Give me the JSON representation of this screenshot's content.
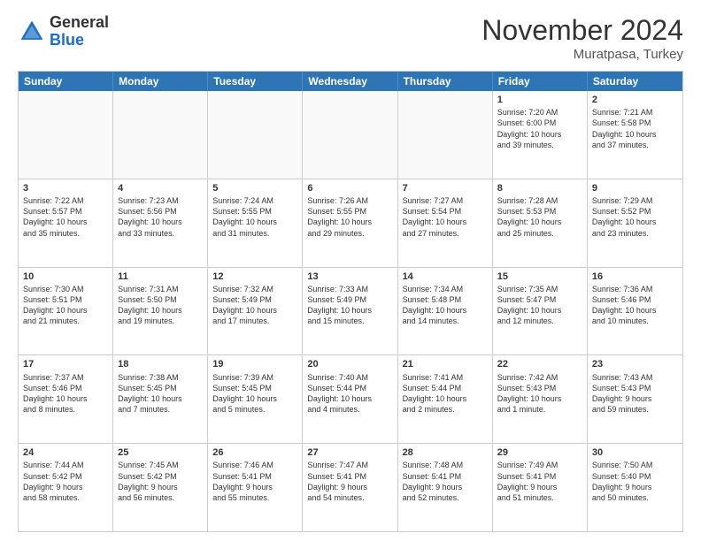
{
  "logo": {
    "general": "General",
    "blue": "Blue"
  },
  "header": {
    "month": "November 2024",
    "location": "Muratpasa, Turkey"
  },
  "weekdays": [
    "Sunday",
    "Monday",
    "Tuesday",
    "Wednesday",
    "Thursday",
    "Friday",
    "Saturday"
  ],
  "rows": [
    [
      {
        "day": "",
        "info": ""
      },
      {
        "day": "",
        "info": ""
      },
      {
        "day": "",
        "info": ""
      },
      {
        "day": "",
        "info": ""
      },
      {
        "day": "",
        "info": ""
      },
      {
        "day": "1",
        "info": "Sunrise: 7:20 AM\nSunset: 6:00 PM\nDaylight: 10 hours\nand 39 minutes."
      },
      {
        "day": "2",
        "info": "Sunrise: 7:21 AM\nSunset: 5:58 PM\nDaylight: 10 hours\nand 37 minutes."
      }
    ],
    [
      {
        "day": "3",
        "info": "Sunrise: 7:22 AM\nSunset: 5:57 PM\nDaylight: 10 hours\nand 35 minutes."
      },
      {
        "day": "4",
        "info": "Sunrise: 7:23 AM\nSunset: 5:56 PM\nDaylight: 10 hours\nand 33 minutes."
      },
      {
        "day": "5",
        "info": "Sunrise: 7:24 AM\nSunset: 5:55 PM\nDaylight: 10 hours\nand 31 minutes."
      },
      {
        "day": "6",
        "info": "Sunrise: 7:26 AM\nSunset: 5:55 PM\nDaylight: 10 hours\nand 29 minutes."
      },
      {
        "day": "7",
        "info": "Sunrise: 7:27 AM\nSunset: 5:54 PM\nDaylight: 10 hours\nand 27 minutes."
      },
      {
        "day": "8",
        "info": "Sunrise: 7:28 AM\nSunset: 5:53 PM\nDaylight: 10 hours\nand 25 minutes."
      },
      {
        "day": "9",
        "info": "Sunrise: 7:29 AM\nSunset: 5:52 PM\nDaylight: 10 hours\nand 23 minutes."
      }
    ],
    [
      {
        "day": "10",
        "info": "Sunrise: 7:30 AM\nSunset: 5:51 PM\nDaylight: 10 hours\nand 21 minutes."
      },
      {
        "day": "11",
        "info": "Sunrise: 7:31 AM\nSunset: 5:50 PM\nDaylight: 10 hours\nand 19 minutes."
      },
      {
        "day": "12",
        "info": "Sunrise: 7:32 AM\nSunset: 5:49 PM\nDaylight: 10 hours\nand 17 minutes."
      },
      {
        "day": "13",
        "info": "Sunrise: 7:33 AM\nSunset: 5:49 PM\nDaylight: 10 hours\nand 15 minutes."
      },
      {
        "day": "14",
        "info": "Sunrise: 7:34 AM\nSunset: 5:48 PM\nDaylight: 10 hours\nand 14 minutes."
      },
      {
        "day": "15",
        "info": "Sunrise: 7:35 AM\nSunset: 5:47 PM\nDaylight: 10 hours\nand 12 minutes."
      },
      {
        "day": "16",
        "info": "Sunrise: 7:36 AM\nSunset: 5:46 PM\nDaylight: 10 hours\nand 10 minutes."
      }
    ],
    [
      {
        "day": "17",
        "info": "Sunrise: 7:37 AM\nSunset: 5:46 PM\nDaylight: 10 hours\nand 8 minutes."
      },
      {
        "day": "18",
        "info": "Sunrise: 7:38 AM\nSunset: 5:45 PM\nDaylight: 10 hours\nand 7 minutes."
      },
      {
        "day": "19",
        "info": "Sunrise: 7:39 AM\nSunset: 5:45 PM\nDaylight: 10 hours\nand 5 minutes."
      },
      {
        "day": "20",
        "info": "Sunrise: 7:40 AM\nSunset: 5:44 PM\nDaylight: 10 hours\nand 4 minutes."
      },
      {
        "day": "21",
        "info": "Sunrise: 7:41 AM\nSunset: 5:44 PM\nDaylight: 10 hours\nand 2 minutes."
      },
      {
        "day": "22",
        "info": "Sunrise: 7:42 AM\nSunset: 5:43 PM\nDaylight: 10 hours\nand 1 minute."
      },
      {
        "day": "23",
        "info": "Sunrise: 7:43 AM\nSunset: 5:43 PM\nDaylight: 9 hours\nand 59 minutes."
      }
    ],
    [
      {
        "day": "24",
        "info": "Sunrise: 7:44 AM\nSunset: 5:42 PM\nDaylight: 9 hours\nand 58 minutes."
      },
      {
        "day": "25",
        "info": "Sunrise: 7:45 AM\nSunset: 5:42 PM\nDaylight: 9 hours\nand 56 minutes."
      },
      {
        "day": "26",
        "info": "Sunrise: 7:46 AM\nSunset: 5:41 PM\nDaylight: 9 hours\nand 55 minutes."
      },
      {
        "day": "27",
        "info": "Sunrise: 7:47 AM\nSunset: 5:41 PM\nDaylight: 9 hours\nand 54 minutes."
      },
      {
        "day": "28",
        "info": "Sunrise: 7:48 AM\nSunset: 5:41 PM\nDaylight: 9 hours\nand 52 minutes."
      },
      {
        "day": "29",
        "info": "Sunrise: 7:49 AM\nSunset: 5:41 PM\nDaylight: 9 hours\nand 51 minutes."
      },
      {
        "day": "30",
        "info": "Sunrise: 7:50 AM\nSunset: 5:40 PM\nDaylight: 9 hours\nand 50 minutes."
      }
    ]
  ]
}
